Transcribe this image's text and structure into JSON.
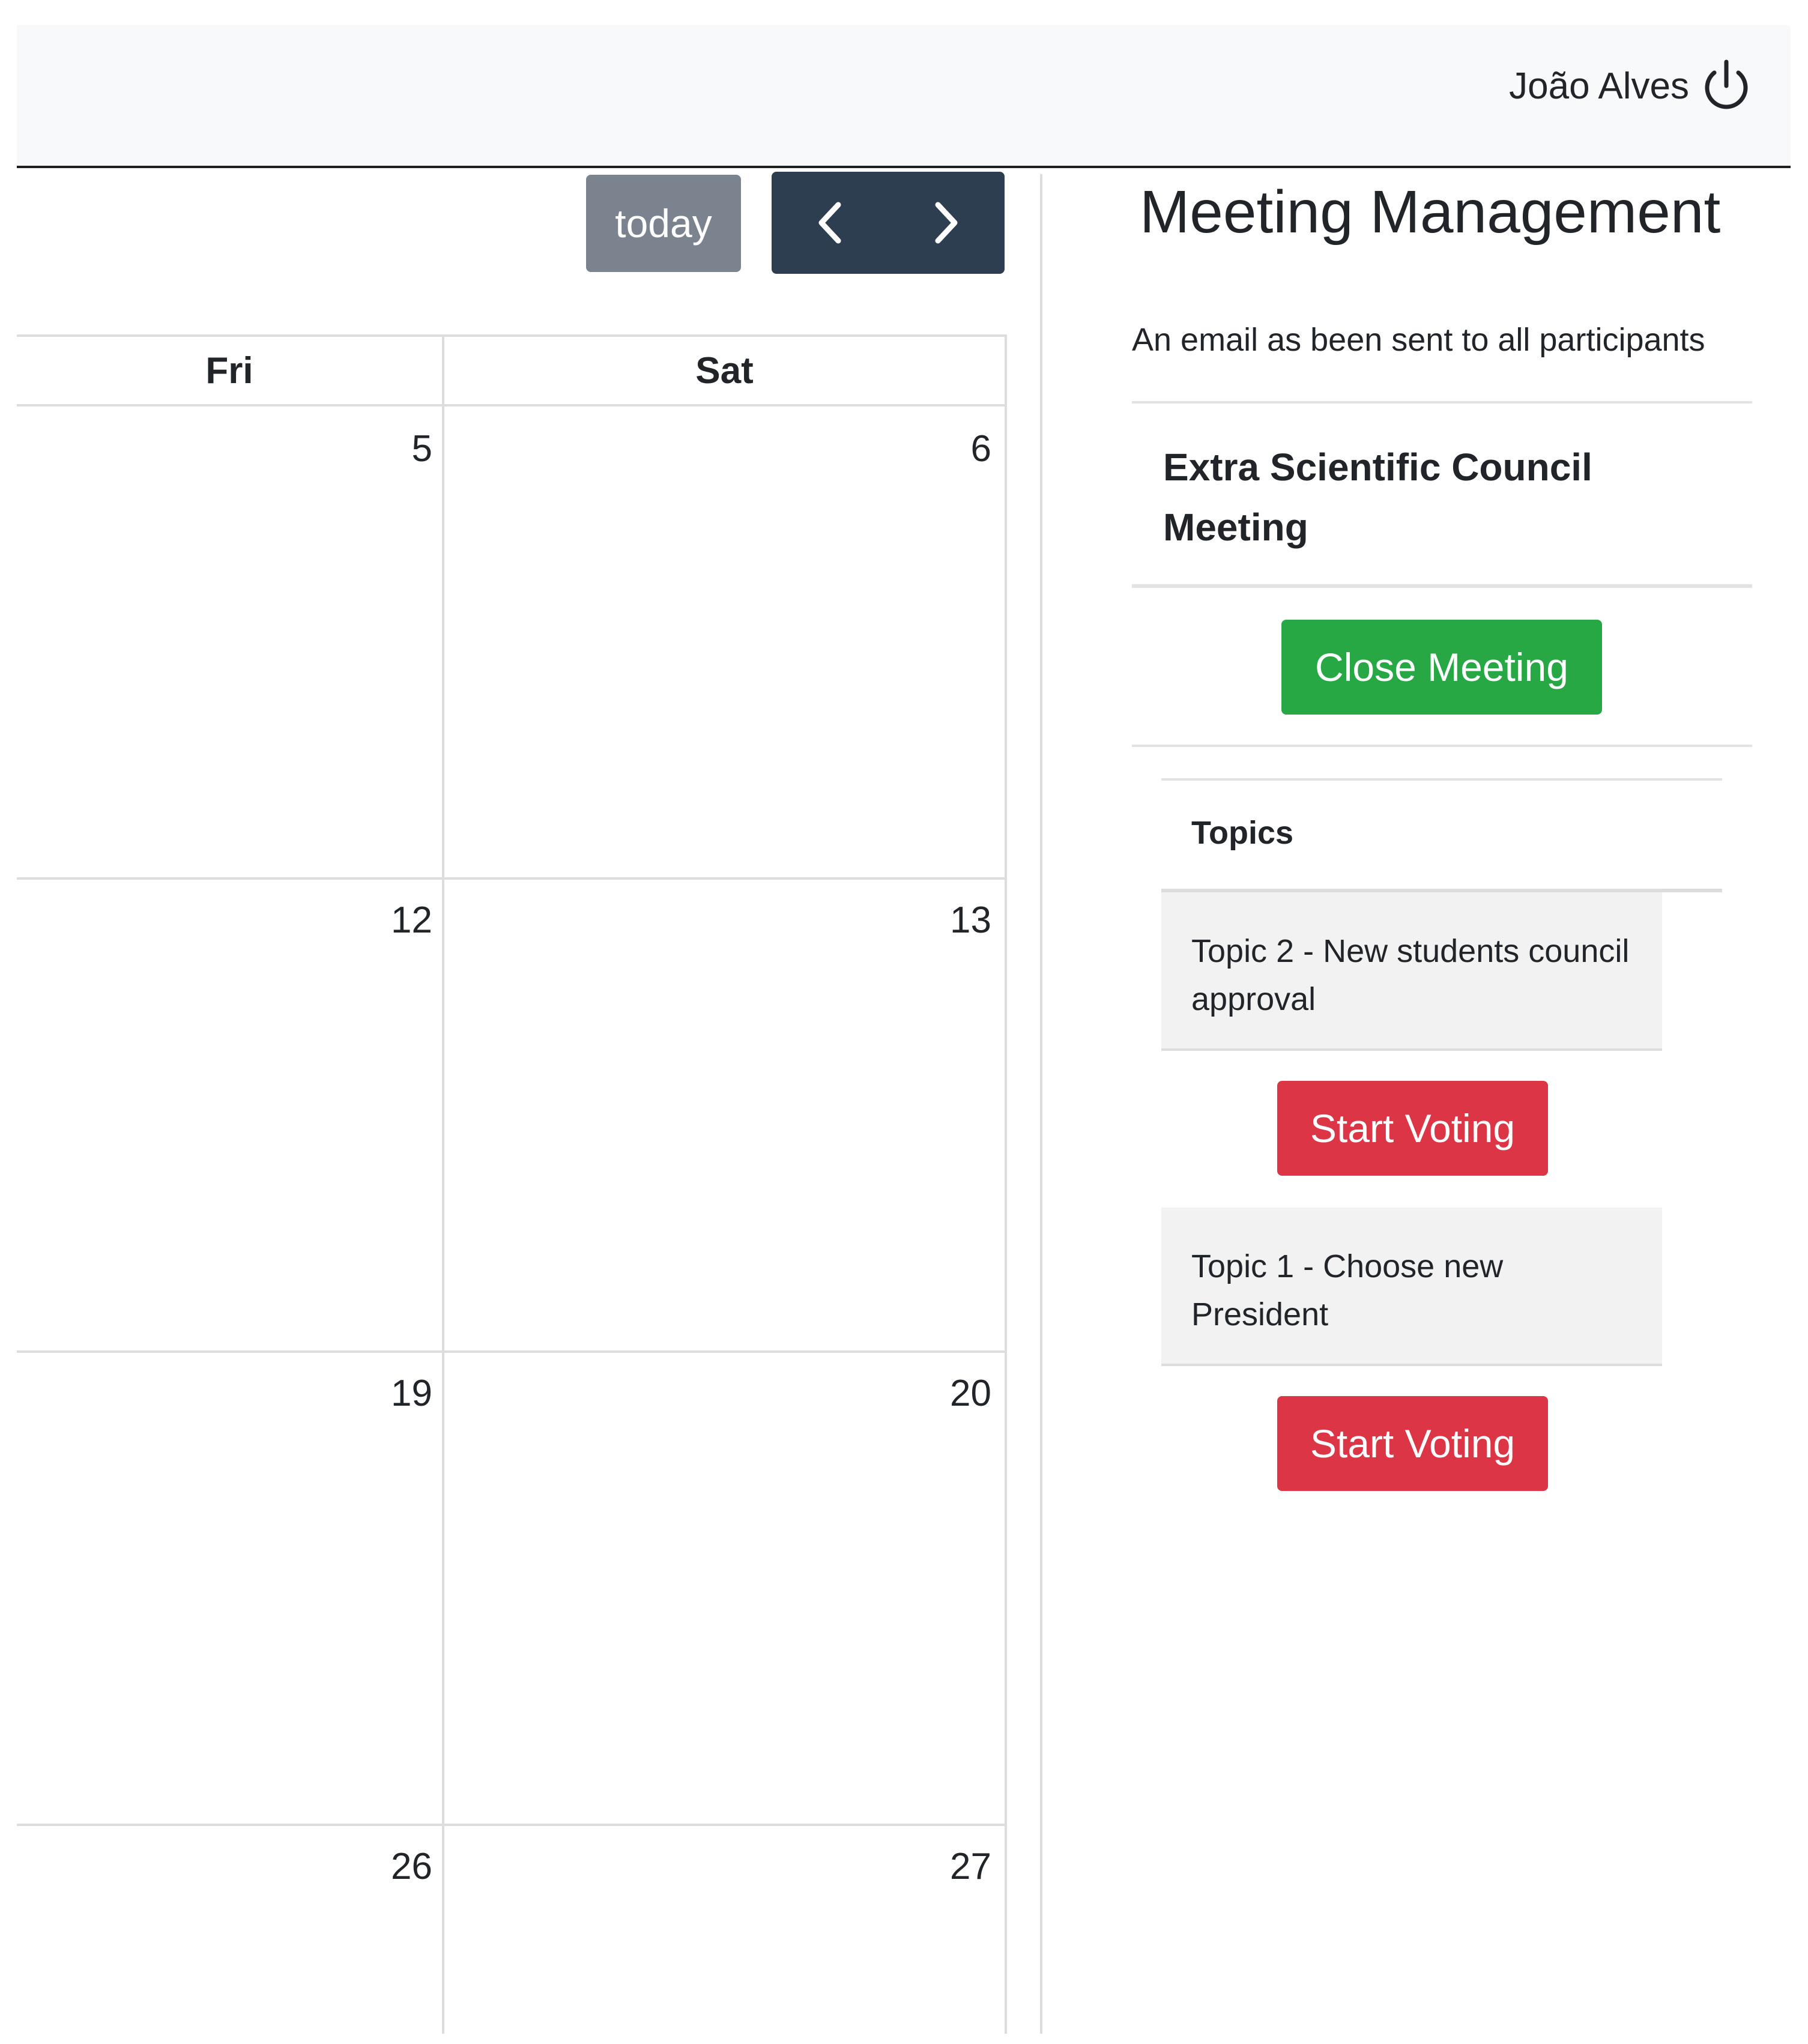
{
  "navbar": {
    "user_name": "João Alves",
    "logout_icon": "power-icon"
  },
  "toolbar": {
    "today_label": "today",
    "prev_icon": "chevron-left-icon",
    "next_icon": "chevron-right-icon"
  },
  "calendar": {
    "columns": [
      "Fri",
      "Sat"
    ],
    "weeks": [
      [
        "5",
        "6"
      ],
      [
        "12",
        "13"
      ],
      [
        "19",
        "20"
      ],
      [
        "26",
        "27"
      ]
    ]
  },
  "panel": {
    "title": "Meeting Management",
    "message": "An email as been sent to all participants",
    "meeting_name": "Extra Scientific Council Meeting",
    "close_button": "Close Meeting",
    "topics_header": "Topics",
    "topics": [
      {
        "label": "Topic 2 - New students council approval",
        "button": "Start Voting"
      },
      {
        "label": "Topic 1 - Choose new President",
        "button": "Start Voting"
      }
    ]
  },
  "colors": {
    "navbar_bg": "#f8f9fa",
    "today_btn": "#7b848e",
    "nav_btn": "#2c3e50",
    "close_btn": "#28a745",
    "vote_btn": "#dc3545"
  }
}
